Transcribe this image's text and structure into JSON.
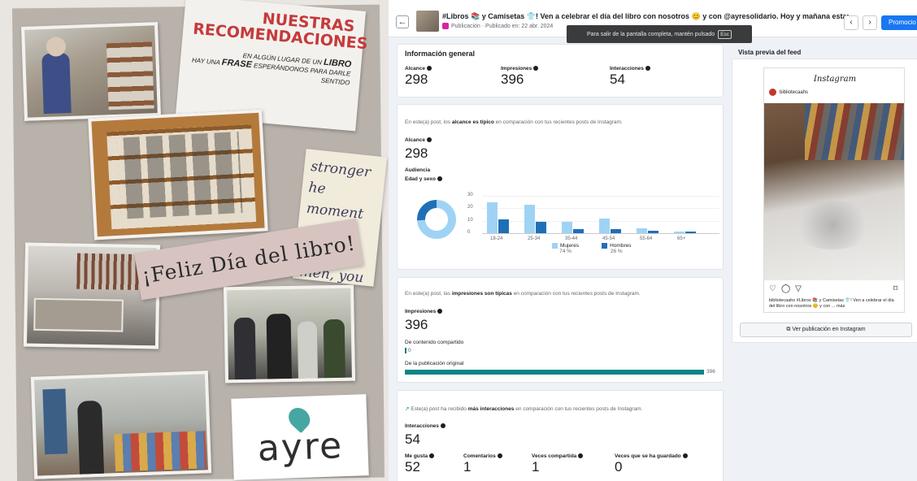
{
  "collage": {
    "rec_title_1": "NUESTRAS",
    "rec_title_2": "RECOMENDACIONES",
    "quote_line1": "EN ALGÚN LUGAR DE UN",
    "quote_libro": "LIBRO",
    "quote_line2a": "HAY UNA",
    "quote_frase": "FRASE",
    "quote_line2b": "ESPERÁNDONOS PARA DARLE SENTIDO",
    "handwriting": "stronger\nhe moment\netter at you\nmen, you\nbe",
    "banner": "¡Feliz Día del libro!",
    "logo": "ayre"
  },
  "header": {
    "back": "←",
    "title": "#Libros 📚 y Camisetas 👕! Ven a celebrar el día del libro con nosotros 😊 y con @ayresolidario. Hoy y mañana estar...",
    "subtitle": "Publicación · Publicado en: 22 abr. 2024",
    "tooltip_text": "Para salir de la pantalla completa, mantén pulsado",
    "tooltip_key": "Esc",
    "prev": "‹",
    "next": "›",
    "promo": "Promocio"
  },
  "general": {
    "title": "Información general",
    "metrics": [
      {
        "label": "Alcance",
        "value": "298"
      },
      {
        "label": "Impresiones",
        "value": "396"
      },
      {
        "label": "Interacciones",
        "value": "54"
      }
    ]
  },
  "reach": {
    "note_pre": "En este(a) post, los",
    "note_bold": "alcance es típico",
    "note_post": "en comparación con tus recientes posts de Instagram.",
    "label": "Alcance",
    "value": "298",
    "audience": "Audiencia",
    "age_sex": "Edad y sexo",
    "legend_women": "Mujeres",
    "legend_women_pct": "74 %",
    "legend_men": "Hombres",
    "legend_men_pct": "26 %",
    "colors": {
      "women": "#9fd3f5",
      "men": "#1f6fb8"
    }
  },
  "chart_data": {
    "type": "bar",
    "categories": [
      "18-24",
      "25-34",
      "35-44",
      "45-54",
      "55-64",
      "65+"
    ],
    "series": [
      {
        "name": "Mujeres",
        "values": [
          25,
          23,
          9,
          12,
          4,
          1
        ]
      },
      {
        "name": "Hombres",
        "values": [
          11,
          9,
          3,
          3,
          2,
          1
        ]
      }
    ],
    "yticks": [
      "30",
      "20",
      "10",
      "0"
    ],
    "ylim": [
      0,
      30
    ],
    "donut_split": [
      74,
      26
    ]
  },
  "impressions": {
    "note_pre": "En este(a) post, las",
    "note_bold": "impresiones son típicas",
    "note_post": "en comparación con tus recientes posts de Instagram.",
    "label": "Impresiones",
    "value": "396",
    "shared_label": "De contenido compartido",
    "shared_value": "0",
    "original_label": "De la publicación original",
    "original_value": "396"
  },
  "interactions": {
    "note_pre": "Este(a) post ha recibido",
    "note_bold": "más interacciones",
    "note_post": "en comparación con tus recientes posts de Instagram.",
    "label": "Interacciones",
    "value": "54",
    "breakdown": [
      {
        "label": "Me gusta",
        "value": "52"
      },
      {
        "label": "Comentarios",
        "value": "1"
      },
      {
        "label": "Veces compartida",
        "value": "1"
      },
      {
        "label": "Veces que se ha guardado",
        "value": "0"
      }
    ]
  },
  "feed": {
    "title": "Vista previa del feed",
    "ig_logo": "Instagram",
    "username": "bibliotecaahs",
    "caption": "bibliotecaahs #Libros 📚 y Camisetas 👕! Ven a celebrar el día del libro con nosotros 😊 y con ... más",
    "view_button": "Ver publicación en Instagram"
  }
}
